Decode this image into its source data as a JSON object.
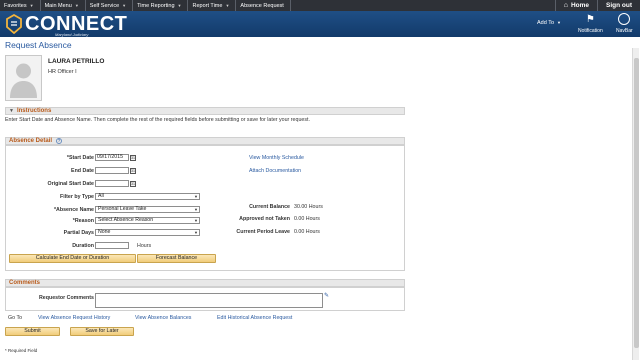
{
  "topnav": {
    "items": [
      {
        "label": "Favorites"
      },
      {
        "label": "Main Menu"
      },
      {
        "label": "Self Service"
      },
      {
        "label": "Time Reporting"
      },
      {
        "label": "Report Time"
      },
      {
        "label": "Absence Request"
      }
    ],
    "home_label": "Home",
    "signout_label": "Sign out"
  },
  "banner": {
    "logo_text": "CONNECT",
    "logo_sub": "Maryland Judiciary",
    "addto_label": "Add To",
    "notification_label": "Notification",
    "navbar_label": "NavBar"
  },
  "page": {
    "title": "Request Absence"
  },
  "person": {
    "name": "LAURA PETRILLO",
    "title": "HR Officer I"
  },
  "instructions": {
    "header": "Instructions",
    "text": "Enter Start Date and Absence Name. Then complete the rest of the required fields before submitting or save for later your request."
  },
  "absence_detail": {
    "header": "Absence Detail",
    "start_date_label": "*Start Date",
    "start_date_value": "09/17/2015",
    "end_date_label": "End Date",
    "end_date_value": "",
    "original_start_label": "Original Start Date",
    "original_start_value": "",
    "filter_label": "Filter by Type",
    "filter_value": "All",
    "absence_name_label": "*Absence Name",
    "absence_name_value": "Personal Leave Take",
    "reason_label": "*Reason",
    "reason_value": "Select Absence Reason",
    "partial_days_label": "Partial Days",
    "partial_days_value": "None",
    "duration_label": "Duration",
    "duration_value": "",
    "duration_unit": "Hours",
    "calc_button": "Calculate End Date or Duration",
    "forecast_button": "Forecast Balance",
    "view_schedule_link": "View Monthly Schedule",
    "attach_doc_link": "Attach Documentation",
    "current_balance_label": "Current Balance",
    "current_balance_value": "30.00 Hours",
    "approved_not_taken_label": "Approved not Taken",
    "approved_not_taken_value": "0.00 Hours",
    "current_period_label": "Current Period Leave",
    "current_period_value": "0.00 Hours"
  },
  "comments": {
    "header": "Comments",
    "requestor_label": "Requestor Comments"
  },
  "goto": {
    "label": "Go To",
    "history_link": "View Absence Request History",
    "balances_link": "View Absence Balances",
    "edit_historical_link": "Edit Historical Absence Request"
  },
  "actions": {
    "submit": "Submit",
    "save_later": "Save for Later"
  },
  "footnote": "* Required Field"
}
